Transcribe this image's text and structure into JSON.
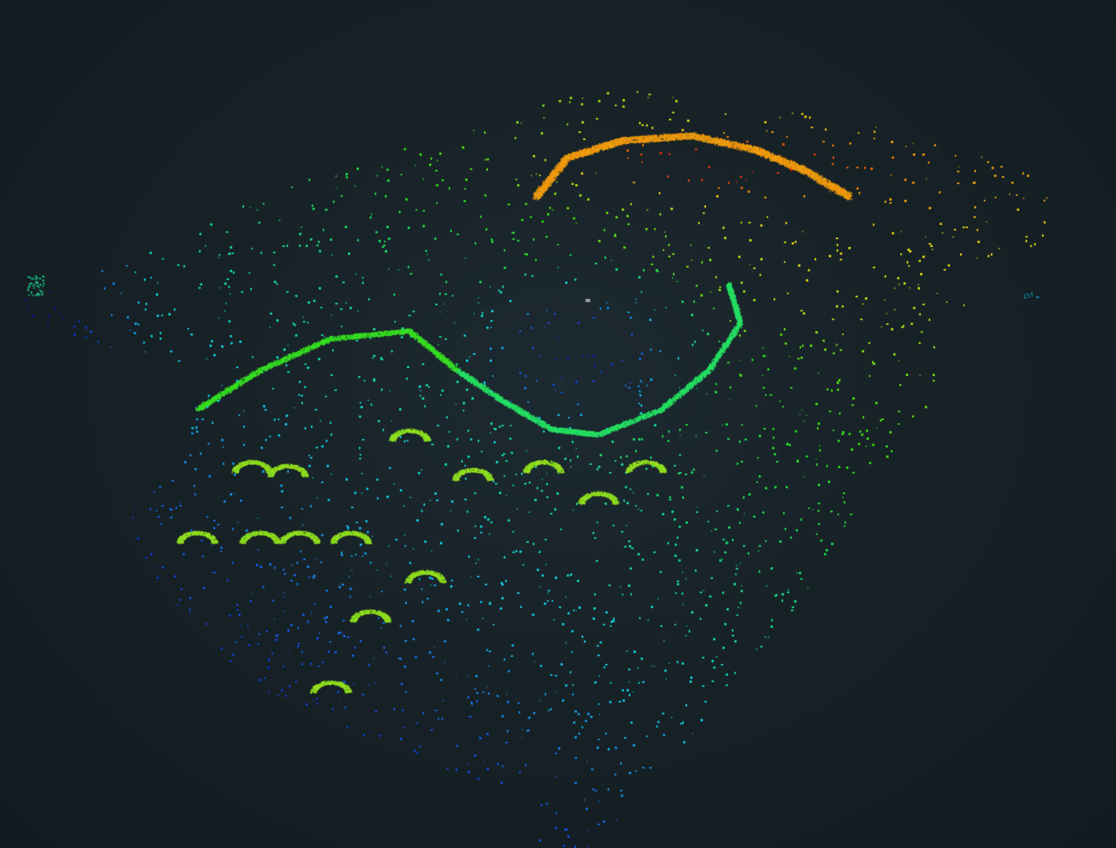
{
  "viewer": {
    "background": "#131c21",
    "colormap": [
      "#0a1a8c",
      "#1f5fe0",
      "#19d3e6",
      "#1ee08a",
      "#34e01e",
      "#9fe020",
      "#e6e01a",
      "#f0a010",
      "#f03c0a"
    ],
    "colormap_name": "elevation-jet",
    "point_color_outlier": "#9aa3a8"
  }
}
